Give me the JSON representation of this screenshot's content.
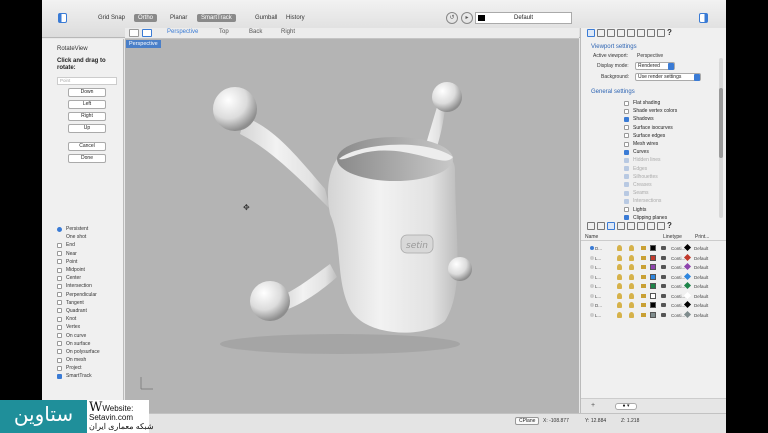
{
  "toolbar": {
    "snaps": [
      {
        "label": "Grid Snap",
        "on": false
      },
      {
        "label": "Ortho",
        "on": true
      },
      {
        "label": "Planar",
        "on": false
      },
      {
        "label": "SmartTrack",
        "on": true
      },
      {
        "label": "Gumball",
        "on": false
      },
      {
        "label": "History",
        "on": false
      }
    ],
    "layer_value": "Default"
  },
  "left_panel": {
    "title": "RotateView",
    "instruction": "Click and drag to rotate:",
    "input_placeholder": "Point",
    "buttons": [
      "Down",
      "Left",
      "Right",
      "Up",
      "Cancel",
      "Done"
    ],
    "osnaps": [
      {
        "label": "Persistent",
        "type": "radio",
        "on": true
      },
      {
        "label": "One shot",
        "type": "none",
        "on": false
      },
      {
        "label": "End",
        "type": "check",
        "on": false
      },
      {
        "label": "Near",
        "type": "check",
        "on": false
      },
      {
        "label": "Point",
        "type": "check",
        "on": false
      },
      {
        "label": "Midpoint",
        "type": "check",
        "on": false
      },
      {
        "label": "Center",
        "type": "check",
        "on": false
      },
      {
        "label": "Intersection",
        "type": "check",
        "on": false
      },
      {
        "label": "Perpendicular",
        "type": "check",
        "on": false
      },
      {
        "label": "Tangent",
        "type": "check",
        "on": false
      },
      {
        "label": "Quadrant",
        "type": "check",
        "on": false
      },
      {
        "label": "Knot",
        "type": "check",
        "on": false
      },
      {
        "label": "Vertex",
        "type": "check",
        "on": false
      },
      {
        "label": "On curve",
        "type": "check",
        "on": false
      },
      {
        "label": "On surface",
        "type": "check",
        "on": false
      },
      {
        "label": "On polysurface",
        "type": "check",
        "on": false
      },
      {
        "label": "On mesh",
        "type": "check",
        "on": false
      },
      {
        "label": "Project",
        "type": "check",
        "on": false
      },
      {
        "label": "SmartTrack",
        "type": "check",
        "on": true
      }
    ]
  },
  "viewport": {
    "tabs": [
      "Perspective",
      "Top",
      "Back",
      "Right"
    ],
    "active_tab": "Perspective",
    "label": "Perspective"
  },
  "status": {
    "plane": "CPlane",
    "x": "X: -108.877",
    "y": "Y: 12.884",
    "z": "Z: 1.218"
  },
  "viewport_settings": {
    "title": "Viewport settings",
    "active_viewport_label": "Active viewport:",
    "active_viewport_value": "Perspective",
    "display_mode_label": "Display mode:",
    "display_mode_value": "Rendered",
    "background_label": "Background:",
    "background_value": "Use render settings",
    "general_title": "General settings",
    "general": [
      {
        "label": "Flat shading",
        "on": false,
        "dim": false
      },
      {
        "label": "Shade vertex colors",
        "on": false,
        "dim": false
      },
      {
        "label": "Shadows",
        "on": true,
        "dim": false
      },
      {
        "label": "Surface isocurves",
        "on": false,
        "dim": false
      },
      {
        "label": "Surface edges",
        "on": false,
        "dim": false
      },
      {
        "label": "Mesh wires",
        "on": false,
        "dim": false
      },
      {
        "label": "Curves",
        "on": true,
        "dim": false
      },
      {
        "label": "Hidden lines",
        "on": true,
        "dim": true
      },
      {
        "label": "Edges",
        "on": true,
        "dim": true
      },
      {
        "label": "Silhouettes",
        "on": true,
        "dim": true
      },
      {
        "label": "Creases",
        "on": true,
        "dim": true
      },
      {
        "label": "Seams",
        "on": true,
        "dim": true
      },
      {
        "label": "Intersections",
        "on": true,
        "dim": true
      },
      {
        "label": "Lights",
        "on": false,
        "dim": false
      },
      {
        "label": "Clipping planes",
        "on": true,
        "dim": false
      }
    ]
  },
  "layers": {
    "headers": {
      "name": "Name",
      "linetype": "Linetype",
      "print": "Print..."
    },
    "rows": [
      {
        "name": "D...",
        "color": "#000000",
        "linetype": "Conti...",
        "print_color": "#000000",
        "print": "Default",
        "current": true
      },
      {
        "name": "L...",
        "color": "#c0392b",
        "linetype": "Conti...",
        "print_color": "#c0392b",
        "print": "Default",
        "current": false
      },
      {
        "name": "L...",
        "color": "#8e44ad",
        "linetype": "Conti...",
        "print_color": "#8e44ad",
        "print": "Default",
        "current": false
      },
      {
        "name": "L...",
        "color": "#2e86de",
        "linetype": "Conti...",
        "print_color": "#2e86de",
        "print": "Default",
        "current": false
      },
      {
        "name": "L...",
        "color": "#1e8449",
        "linetype": "Conti...",
        "print_color": "#1e8449",
        "print": "Default",
        "current": false
      },
      {
        "name": "L...",
        "color": "#ffffff",
        "linetype": "Conti...",
        "print_color": "#ffffff",
        "print": "Default",
        "current": false
      },
      {
        "name": "D...",
        "color": "#000000",
        "linetype": "Conti...",
        "print_color": "#000000",
        "print": "Default",
        "current": false
      },
      {
        "name": "L...",
        "color": "#7f8c8d",
        "linetype": "Conti...",
        "print_color": "#7f8c8d",
        "print": "Default",
        "current": false
      }
    ]
  },
  "watermark": {
    "logo_text": "ستاوین",
    "website_label": "Website:",
    "website": "Setavin.com",
    "tagline": "شبکه معماری ایران"
  },
  "colors": {
    "accent": "#3a7bd5",
    "viewport_bg": "#b4b4b4",
    "watermark_bg": "#1f8f9a"
  }
}
